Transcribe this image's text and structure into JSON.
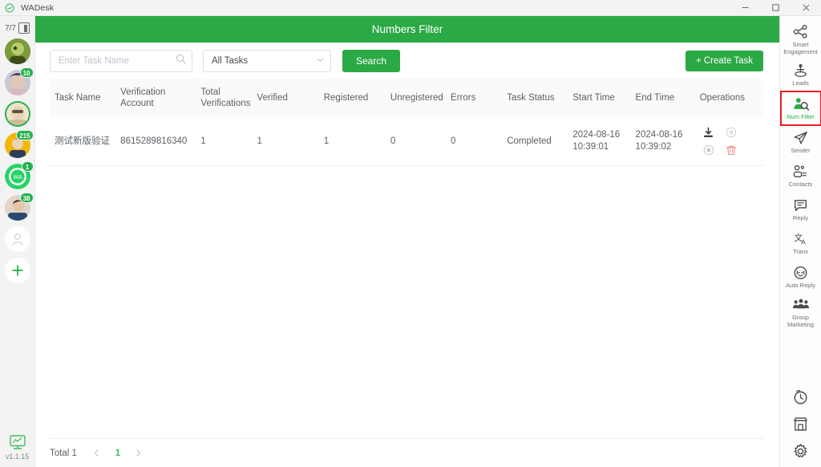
{
  "window": {
    "app_name": "WADesk",
    "logo_icon": "wadesk-logo-icon",
    "minimize_icon": "minimize-icon",
    "maximize_icon": "maximize-icon",
    "close_icon": "close-icon"
  },
  "left_rail": {
    "account_count": "7/7",
    "collapse_icon": "collapse-panel-icon",
    "accounts": [
      {
        "name": "account-1",
        "badge": "",
        "selected": false,
        "colors": [
          "#6b8e23",
          "#2f4f1a"
        ]
      },
      {
        "name": "account-2",
        "badge": "10",
        "selected": false,
        "colors": [
          "#b6b8c4",
          "#3b3f6b"
        ]
      },
      {
        "name": "account-3",
        "badge": "",
        "selected": true,
        "colors": [
          "#d8c39a",
          "#7a6340"
        ]
      },
      {
        "name": "account-4",
        "badge": "215",
        "selected": false,
        "colors": [
          "#f2b705",
          "#c98a00"
        ]
      },
      {
        "name": "account-5",
        "badge": "1",
        "selected": false,
        "colors": [
          "#25d366",
          "#1aa34a"
        ],
        "is_wa": true,
        "wa_label": "WA"
      },
      {
        "name": "account-6",
        "badge": "38",
        "selected": false,
        "colors": [
          "#c98f72",
          "#2b4a6f"
        ]
      }
    ],
    "contact_placeholder_icon": "person-placeholder-icon",
    "add_account_icon": "plus-icon",
    "status_icon": "monitor-chart-icon",
    "version": "v1.1.15"
  },
  "page": {
    "title": "Numbers Filter"
  },
  "toolbar": {
    "search_placeholder": "Enter Task Name",
    "search_value": "",
    "search_field_icon": "search-icon",
    "filter_selected": "All Tasks",
    "filter_chevron_icon": "chevron-down-icon",
    "search_button": "Search",
    "create_button": "+ Create Task"
  },
  "table": {
    "columns": [
      "Task Name",
      "Verification Account",
      "Total Verifications",
      "Verified",
      "Registered",
      "Unregistered",
      "Errors",
      "Task Status",
      "Start Time",
      "End Time",
      "Operations"
    ],
    "rows": [
      {
        "task_name": "测试新版验证",
        "verification_account": "8615289816340",
        "total_verifications": "1",
        "verified": "1",
        "registered": "1",
        "unregistered": "0",
        "errors": "0",
        "task_status": "Completed",
        "start_date": "2024-08-16",
        "start_time": "10:39:01",
        "end_date": "2024-08-16",
        "end_time": "10:39:02",
        "operations": [
          {
            "name": "download-icon",
            "enabled": true
          },
          {
            "name": "pause-icon",
            "enabled": false
          },
          {
            "name": "stop-icon",
            "enabled": false
          },
          {
            "name": "delete-icon",
            "enabled": true
          }
        ]
      }
    ]
  },
  "footer": {
    "total_label": "Total 1",
    "prev_icon": "chevron-left-icon",
    "current_page": "1",
    "next_icon": "chevron-right-icon"
  },
  "right_rail": {
    "items": [
      {
        "label": "Smart Engagement",
        "icon": "share-nodes-icon",
        "active": false
      },
      {
        "label": "Leads",
        "icon": "leads-person-icon",
        "active": false
      },
      {
        "label": "Num Filter",
        "icon": "number-filter-icon",
        "active": true
      },
      {
        "label": "Sender",
        "icon": "paper-plane-icon",
        "active": false
      },
      {
        "label": "Contacts",
        "icon": "contacts-icon",
        "active": false
      },
      {
        "label": "Reply",
        "icon": "reply-chat-icon",
        "active": false
      },
      {
        "label": "Trans",
        "icon": "translate-icon",
        "active": false
      },
      {
        "label": "Auto Reply",
        "icon": "auto-reply-headset-icon",
        "active": false
      },
      {
        "label": "Group Marketing",
        "icon": "group-marketing-icon",
        "active": false
      }
    ],
    "bottom_items": [
      {
        "label": "",
        "icon": "timer-clock-icon"
      },
      {
        "label": "",
        "icon": "store-icon"
      },
      {
        "label": "",
        "icon": "settings-gear-icon"
      }
    ]
  },
  "colors": {
    "brand_green": "#2BA945",
    "status_green": "#3fbd5f",
    "highlight_red": "#ec2027"
  }
}
